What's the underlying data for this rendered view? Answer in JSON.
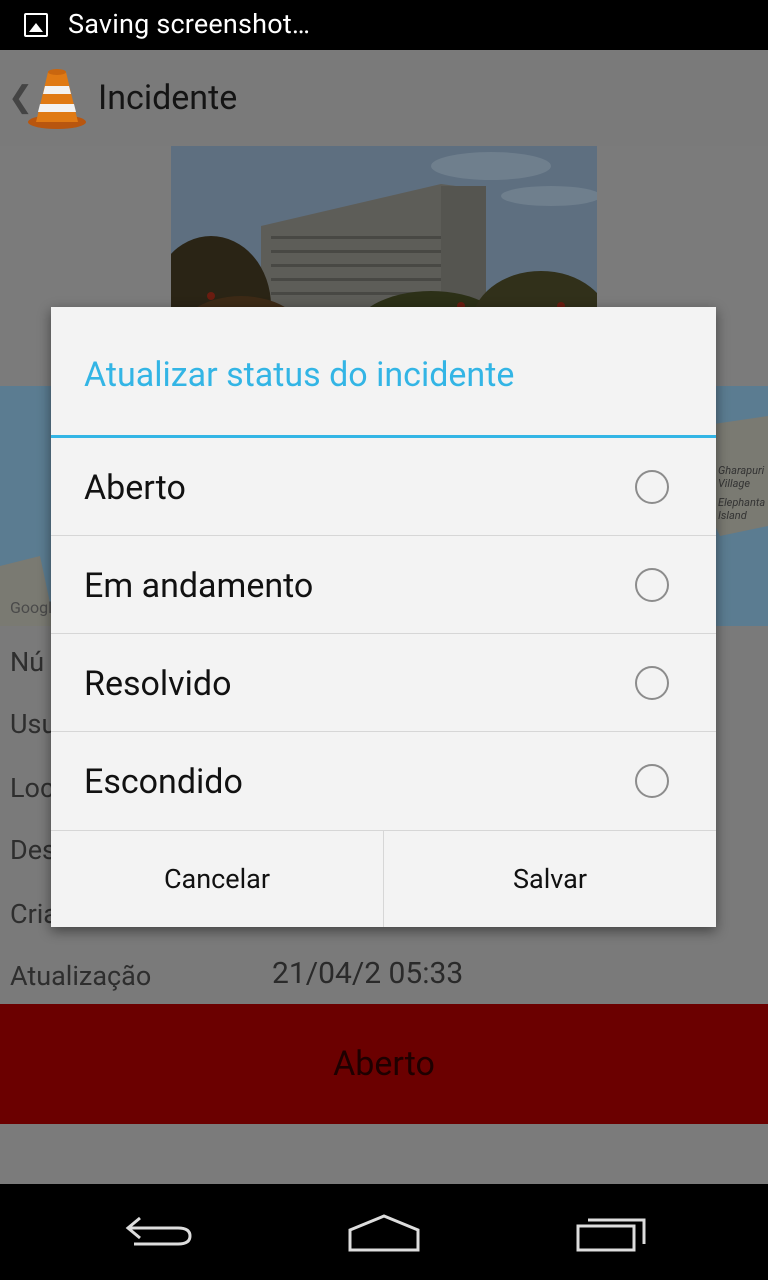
{
  "status_bar": {
    "notification_text": "Saving screenshot…",
    "icon": "image-icon"
  },
  "action_bar": {
    "title": "Incidente",
    "logo": "traffic-cone-icon",
    "back": "chevron-left-icon"
  },
  "map": {
    "labels": [
      "Gharapuri Village",
      "Elephanta Island",
      "Google"
    ]
  },
  "details": {
    "rows": [
      {
        "label": "Nú"
      },
      {
        "label": "Usu"
      },
      {
        "label": "Loc"
      },
      {
        "label": "Des"
      },
      {
        "label": "Cria"
      },
      {
        "label": "Atualização",
        "value": "21/04/2 05:33"
      }
    ]
  },
  "status_banner": {
    "text": "Aberto",
    "color": "#6b0000"
  },
  "dialog": {
    "title": "Atualizar status do incidente",
    "accent": "#33b5e5",
    "options": [
      {
        "label": "Aberto",
        "selected": false
      },
      {
        "label": "Em andamento",
        "selected": false
      },
      {
        "label": "Resolvido",
        "selected": false
      },
      {
        "label": "Escondido",
        "selected": false
      }
    ],
    "cancel_label": "Cancelar",
    "save_label": "Salvar"
  },
  "nav_bar": {
    "icons": [
      "back-icon",
      "home-icon",
      "recent-apps-icon"
    ]
  }
}
